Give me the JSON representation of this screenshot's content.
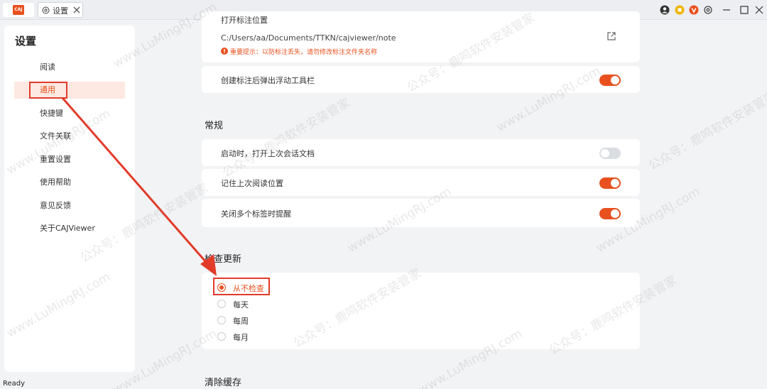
{
  "titlebar": {
    "logo_text": "CAJ",
    "tab_label": "设置"
  },
  "sidebar": {
    "title": "设置",
    "items": [
      {
        "label": "阅读"
      },
      {
        "label": "通用"
      },
      {
        "label": "快捷键"
      },
      {
        "label": "文件关联"
      },
      {
        "label": "重置设置"
      },
      {
        "label": "使用帮助"
      },
      {
        "label": "意见反馈"
      },
      {
        "label": "关于CAJViewer"
      }
    ],
    "active_index": 1
  },
  "main": {
    "annotation_location": {
      "label": "打开标注位置",
      "path": "C:/Users/aa/Documents/TTKN/cajviewer/note",
      "warning": "重要提示：以防标注丢失，请勿修改标注文件夹名称"
    },
    "popup_toolbar": {
      "label": "创建标注后弹出浮动工具栏",
      "on": true
    },
    "general": {
      "title": "常规",
      "rows": [
        {
          "label": "启动时，打开上次会话文档",
          "on": false
        },
        {
          "label": "记住上次阅读位置",
          "on": true
        },
        {
          "label": "关闭多个标签时提醒",
          "on": true
        }
      ]
    },
    "update": {
      "title": "检查更新",
      "options": [
        {
          "label": "从不检查",
          "checked": true
        },
        {
          "label": "每天",
          "checked": false
        },
        {
          "label": "每周",
          "checked": false
        },
        {
          "label": "每月",
          "checked": false
        }
      ]
    },
    "clear_cache": {
      "title": "清除缓存"
    }
  },
  "status": {
    "text": "Ready"
  },
  "colors": {
    "accent": "#e8501e",
    "annotation_red": "#e23b2a"
  },
  "watermark": {
    "text_a": "公众号：鹿鸣软件安装管家",
    "text_b": "www.LuMingRJ.com"
  }
}
